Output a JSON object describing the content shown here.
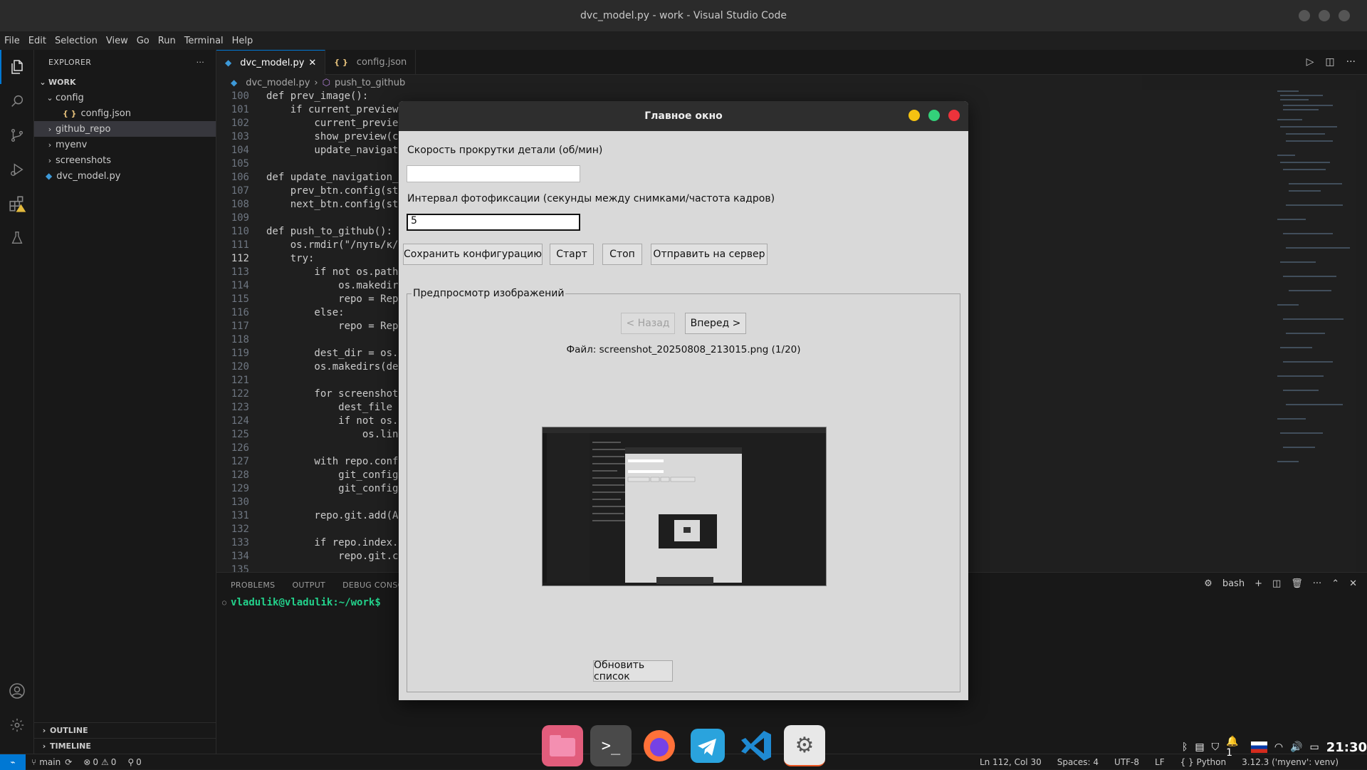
{
  "window": {
    "title": "dvc_model.py - work - Visual Studio Code"
  },
  "menu": [
    "File",
    "Edit",
    "Selection",
    "View",
    "Go",
    "Run",
    "Terminal",
    "Help"
  ],
  "activity_bar": [
    "files-icon",
    "search-icon",
    "source-control-icon",
    "run-debug-icon",
    "extensions-icon",
    "testing-icon",
    "account-icon",
    "settings-icon"
  ],
  "sidebar": {
    "title": "EXPLORER",
    "more": "···",
    "root": "WORK",
    "items": [
      {
        "label": "config",
        "kind": "folder-open",
        "depth": 1
      },
      {
        "label": "config.json",
        "kind": "json",
        "depth": 2
      },
      {
        "label": "github_repo",
        "kind": "folder",
        "depth": 1
      },
      {
        "label": "myenv",
        "kind": "folder",
        "depth": 1
      },
      {
        "label": "screenshots",
        "kind": "folder",
        "depth": 1
      },
      {
        "label": "dvc_model.py",
        "kind": "python",
        "depth": 1
      }
    ],
    "outline": "OUTLINE",
    "timeline": "TIMELINE"
  },
  "tabs": [
    {
      "label": "dvc_model.py",
      "active": true
    },
    {
      "label": "config.json",
      "active": false
    }
  ],
  "breadcrumb": {
    "file": "dvc_model.py",
    "symbol": "push_to_github"
  },
  "code": {
    "current_line": 112,
    "lines": [
      {
        "n": 100,
        "t": "def prev_image():"
      },
      {
        "n": 101,
        "t": "    if current_preview"
      },
      {
        "n": 102,
        "t": "        current_previe"
      },
      {
        "n": 103,
        "t": "        show_preview(c"
      },
      {
        "n": 104,
        "t": "        update_navigat"
      },
      {
        "n": 105,
        "t": ""
      },
      {
        "n": 106,
        "t": "def update_navigation_"
      },
      {
        "n": 107,
        "t": "    prev_btn.config(st"
      },
      {
        "n": 108,
        "t": "    next_btn.config(st"
      },
      {
        "n": 109,
        "t": ""
      },
      {
        "n": 110,
        "t": "def push_to_github():"
      },
      {
        "n": 111,
        "t": "    os.rmdir(\"/путь/к/"
      },
      {
        "n": 112,
        "t": "    try:"
      },
      {
        "n": 113,
        "t": "        if not os.path"
      },
      {
        "n": 114,
        "t": "            os.makedir"
      },
      {
        "n": 115,
        "t": "            repo = Rep"
      },
      {
        "n": 116,
        "t": "        else:"
      },
      {
        "n": 117,
        "t": "            repo = Rep"
      },
      {
        "n": 118,
        "t": ""
      },
      {
        "n": 119,
        "t": "        dest_dir = os."
      },
      {
        "n": 120,
        "t": "        os.makedirs(de"
      },
      {
        "n": 121,
        "t": ""
      },
      {
        "n": 122,
        "t": "        for screenshot"
      },
      {
        "n": 123,
        "t": "            dest_file "
      },
      {
        "n": 124,
        "t": "            if not os."
      },
      {
        "n": 125,
        "t": "                os.lin"
      },
      {
        "n": 126,
        "t": ""
      },
      {
        "n": 127,
        "t": "        with repo.conf"
      },
      {
        "n": 128,
        "t": "            git_config"
      },
      {
        "n": 129,
        "t": "            git_config"
      },
      {
        "n": 130,
        "t": ""
      },
      {
        "n": 131,
        "t": "        repo.git.add(A"
      },
      {
        "n": 132,
        "t": ""
      },
      {
        "n": 133,
        "t": "        if repo.index."
      },
      {
        "n": 134,
        "t": "            repo.git.c"
      },
      {
        "n": 135,
        "t": ""
      }
    ]
  },
  "panel": {
    "tabs": [
      "PROBLEMS",
      "OUTPUT",
      "DEBUG CONSOLE"
    ],
    "prompt": "vladulik@vladulik:~/work$",
    "shell": "bash"
  },
  "statusbar": {
    "branch": "main",
    "errors": "0",
    "warnings": "0",
    "ports": "0",
    "position": "Ln 112, Col 30",
    "spaces": "Spaces: 4",
    "encoding": "UTF-8",
    "eol": "LF",
    "language": "Python",
    "interpreter": "3.12.3 ('myenv': venv)"
  },
  "tray": {
    "clock": "21:30",
    "notif": "1"
  },
  "dock": [
    "files-icon",
    "terminal-icon",
    "firefox-icon",
    "telegram-icon",
    "vscode-icon",
    "settings-icon"
  ],
  "dialog": {
    "title": "Главное окно",
    "speed_label": "Скорость прокрутки детали (об/мин)",
    "speed_value": "",
    "interval_label": "Интервал фотофиксации (секунды между снимками/частота кадров)",
    "interval_value": "5",
    "save_button": "Сохранить конфигурацию",
    "start_button": "Старт",
    "stop_button": "Стоп",
    "send_button": "Отправить на сервер",
    "preview_group": "Предпросмотр изображений",
    "back_button": "< Назад",
    "forward_button": "Вперед >",
    "file_label": "Файл: screenshot_20250808_213015.png (1/20)",
    "refresh_button": "Обновить список"
  }
}
